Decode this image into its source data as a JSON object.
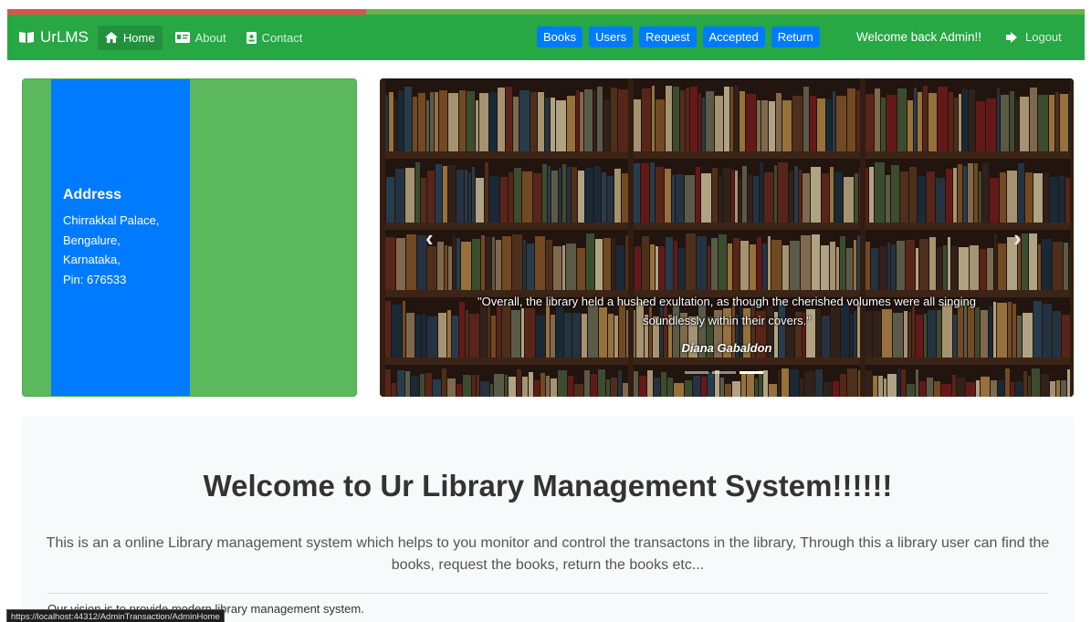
{
  "progress": {
    "fraction": 0.333,
    "fill_color": "#d9534f",
    "track_color": "#6ab04c"
  },
  "navbar": {
    "brand": "UrLMS",
    "brand_icon": "book-open-icon",
    "links": [
      {
        "label": "Home",
        "icon": "home-icon",
        "active": true
      },
      {
        "label": "About",
        "icon": "id-card-icon",
        "active": false
      },
      {
        "label": "Contact",
        "icon": "contact-icon",
        "active": false
      }
    ],
    "buttons": [
      "Books",
      "Users",
      "Request",
      "Accepted",
      "Return"
    ],
    "welcome": "Welcome back Admin!!",
    "logout_label": "Logout",
    "logout_icon": "sign-out-icon",
    "color": "#28a745"
  },
  "address": {
    "title": "Address",
    "lines": [
      "Chirrakkal Palace,",
      "Bengalure,",
      "Karnataka,",
      "Pin: 676533"
    ]
  },
  "carousel": {
    "prev_icon": "chevron-left-icon",
    "next_icon": "chevron-right-icon",
    "caption": "\"Overall, the library held a hushed exultation, as though the cherished volumes were all singing soundlessly within their covers.\"",
    "author": "Diana Gabaldon",
    "slide_count": 3,
    "active_slide": 3
  },
  "jumbotron": {
    "title": "Welcome to Ur Library Management System!!!!!!",
    "lead": "This is an a online Library management system which helps to you monitor and control the transactons in the library, Through this a library user can find the books, request the books, return the books etc...",
    "vision": "Our vision is to provide modern library management system."
  },
  "status_bar": {
    "url": "https://localhost:44312/AdminTransaction/AdminHome"
  }
}
